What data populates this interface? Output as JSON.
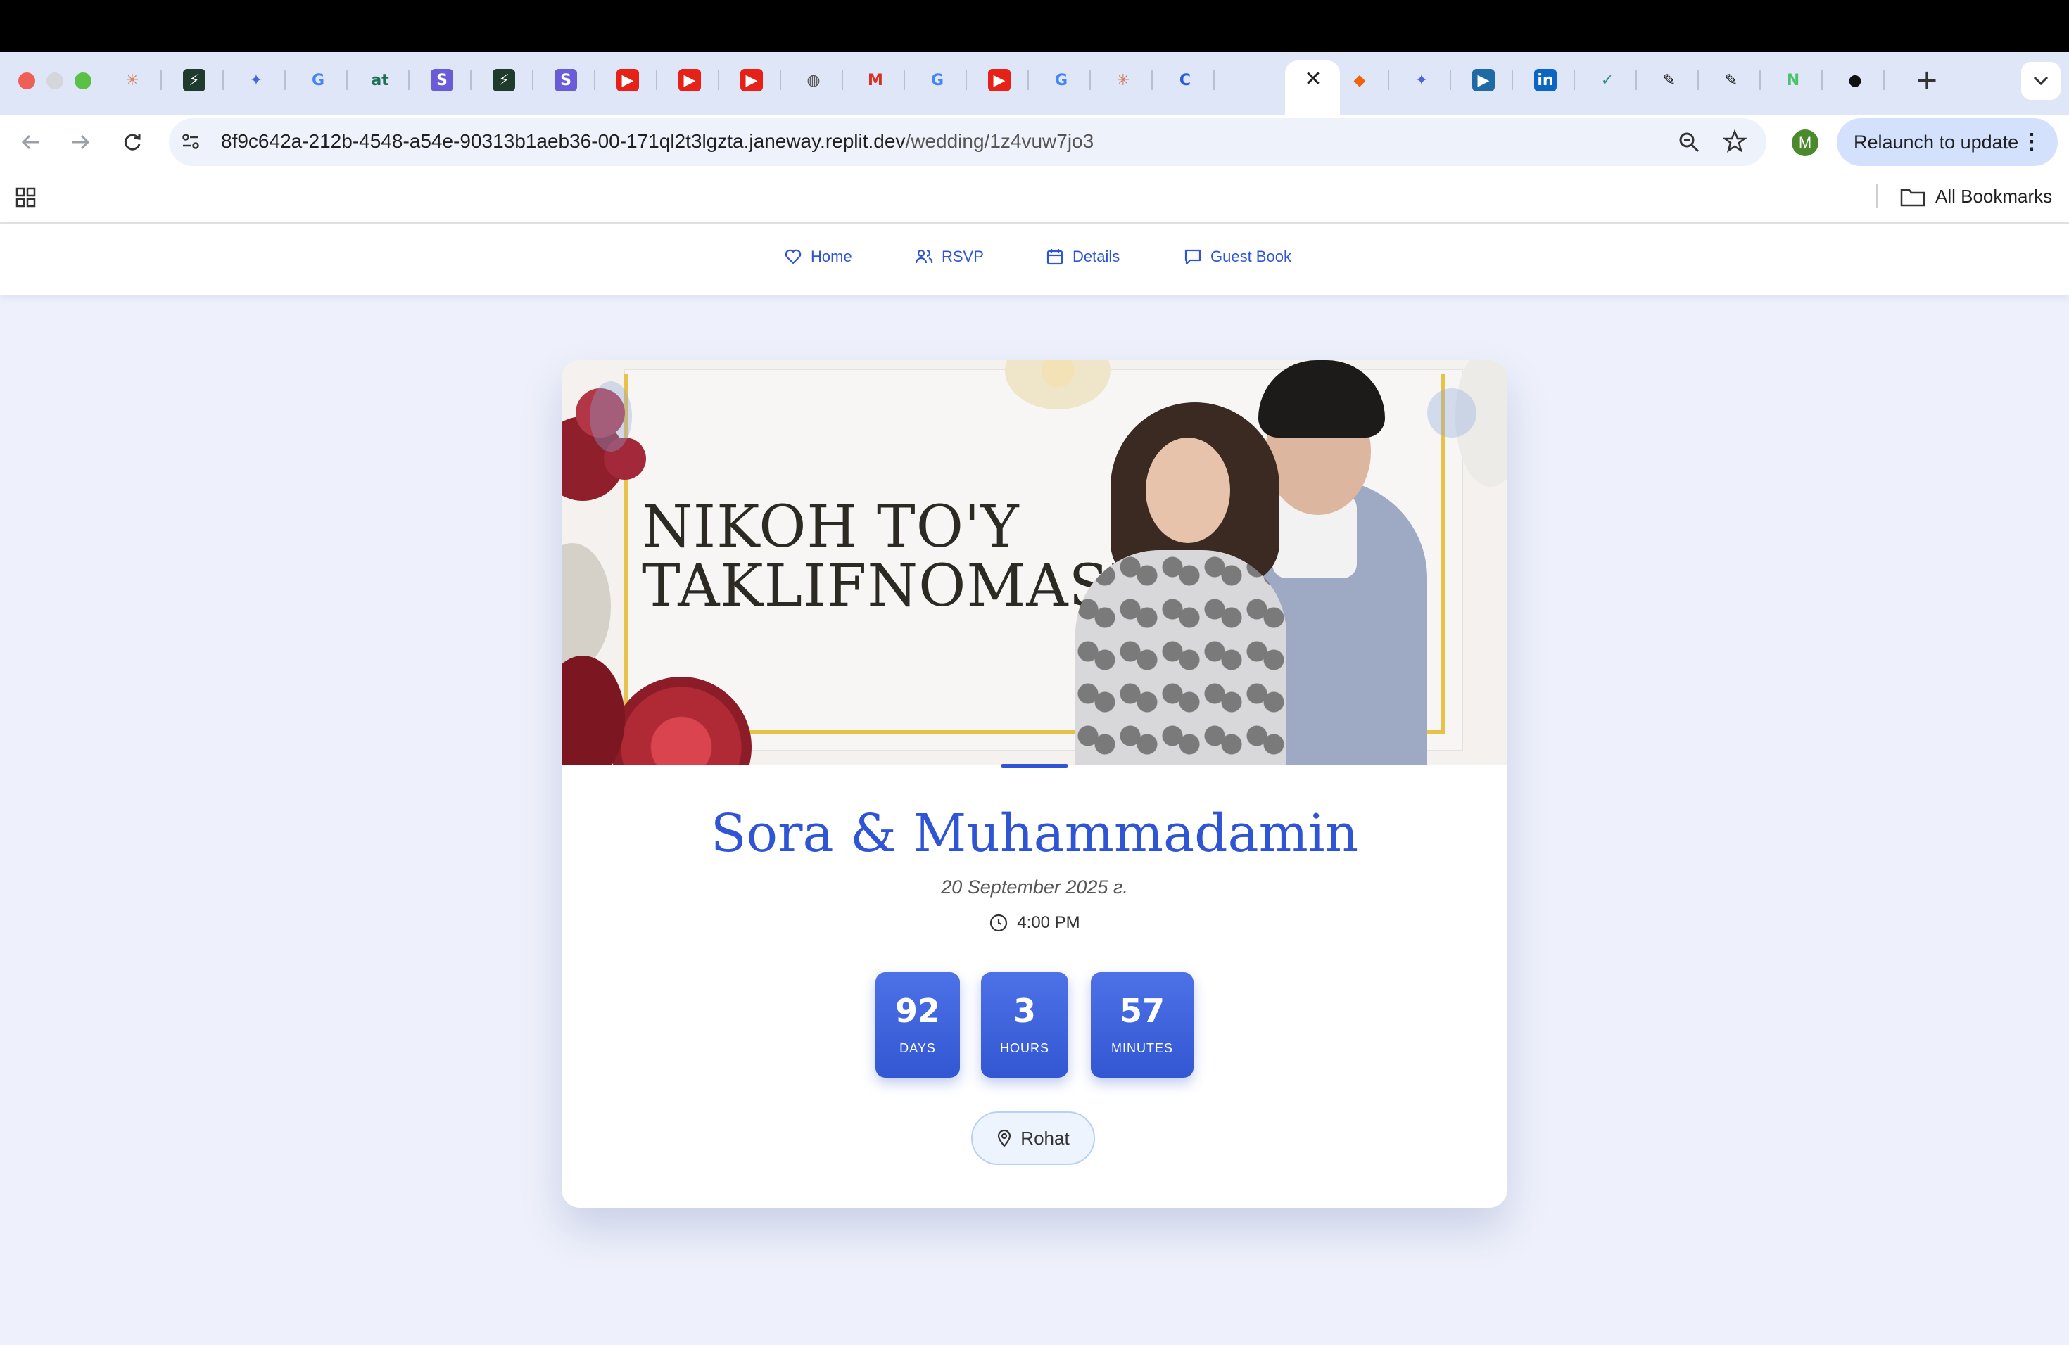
{
  "browser": {
    "tabs": [
      {
        "icon": "claude-icon",
        "color": "#d97757"
      },
      {
        "icon": "lightning-app-icon",
        "color": "#1f3b2c"
      },
      {
        "icon": "bird-logo-icon",
        "color": "#4a66d6"
      },
      {
        "icon": "google-icon",
        "color": "#4285f4"
      },
      {
        "icon": "at-logo-icon",
        "color": "#1f6f54"
      },
      {
        "icon": "s-logo-icon",
        "color": "#6a5bd6"
      },
      {
        "icon": "lightning-app-icon",
        "color": "#1f3b2c"
      },
      {
        "icon": "s-logo-icon",
        "color": "#6a5bd6"
      },
      {
        "icon": "youtube-icon",
        "color": "#e62117"
      },
      {
        "icon": "youtube-icon",
        "color": "#e62117"
      },
      {
        "icon": "youtube-icon",
        "color": "#e62117"
      },
      {
        "icon": "globe-icon",
        "color": "#555555"
      },
      {
        "icon": "gmail-icon",
        "color": "#d93025"
      },
      {
        "icon": "google-icon",
        "color": "#4285f4"
      },
      {
        "icon": "youtube-icon",
        "color": "#e62117"
      },
      {
        "icon": "google-icon",
        "color": "#4285f4"
      },
      {
        "icon": "claude-icon",
        "color": "#d97757"
      },
      {
        "icon": "c-logo-icon",
        "color": "#2b5bd8"
      },
      {
        "icon": "replit-icon",
        "color": "#f26207"
      },
      {
        "icon": "replit-icon",
        "color": "#f26207"
      },
      {
        "icon": "bird-logo-icon",
        "color": "#4a66d6"
      },
      {
        "icon": "video-icon",
        "color": "#1f6aa5"
      },
      {
        "icon": "linkedin-icon",
        "color": "#0a66c2"
      },
      {
        "icon": "translate-icon",
        "color": "#2a8a8a"
      },
      {
        "icon": "pen-icon",
        "color": "#111111"
      },
      {
        "icon": "pen-check-icon",
        "color": "#111111"
      },
      {
        "icon": "n-logo-icon",
        "color": "#49c26a"
      },
      {
        "icon": "github-icon",
        "color": "#111111"
      }
    ],
    "url_host": "8f9c642a-212b-4548-a54e-90313b1aeb36-00-171ql2t3lgzta.janeway.replit.dev",
    "url_path": "/wedding/1z4vuw7jo3",
    "profile_initial": "M",
    "relaunch_label": "Relaunch to update",
    "all_bookmarks_label": "All Bookmarks"
  },
  "site_nav": {
    "items": [
      {
        "label": "Home",
        "icon": "heart-icon"
      },
      {
        "label": "RSVP",
        "icon": "users-icon"
      },
      {
        "label": "Details",
        "icon": "calendar-icon"
      },
      {
        "label": "Guest Book",
        "icon": "message-icon"
      }
    ]
  },
  "invitation": {
    "banner_title_line1": "NIKOH TO'Y",
    "banner_title_line2": "TAKLIFNOMASI",
    "names": "Sora & Muhammadamin",
    "date": "20 September 2025 г.",
    "time": "4:00 PM",
    "countdown": [
      {
        "value": "92",
        "label": "DAYS"
      },
      {
        "value": "3",
        "label": "HOURS"
      },
      {
        "value": "57",
        "label": "MINUTES"
      }
    ],
    "location": "Rohat"
  },
  "colors": {
    "accent": "#2f55d4",
    "page_bg": "#eef1fb",
    "countdown_bg": "#3f63de"
  }
}
